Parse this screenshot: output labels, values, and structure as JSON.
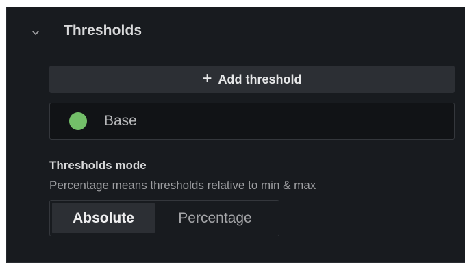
{
  "section": {
    "title": "Thresholds",
    "chevron_icon": "chevron-down-icon"
  },
  "add_threshold": {
    "icon": "plus-icon",
    "icon_glyph": "+",
    "label": "Add threshold"
  },
  "thresholds": [
    {
      "color": "#73bf69",
      "label": "Base"
    }
  ],
  "mode": {
    "title": "Thresholds mode",
    "description": "Percentage means thresholds relative to min & max",
    "options": [
      "Absolute",
      "Percentage"
    ],
    "selected": "Absolute"
  }
}
